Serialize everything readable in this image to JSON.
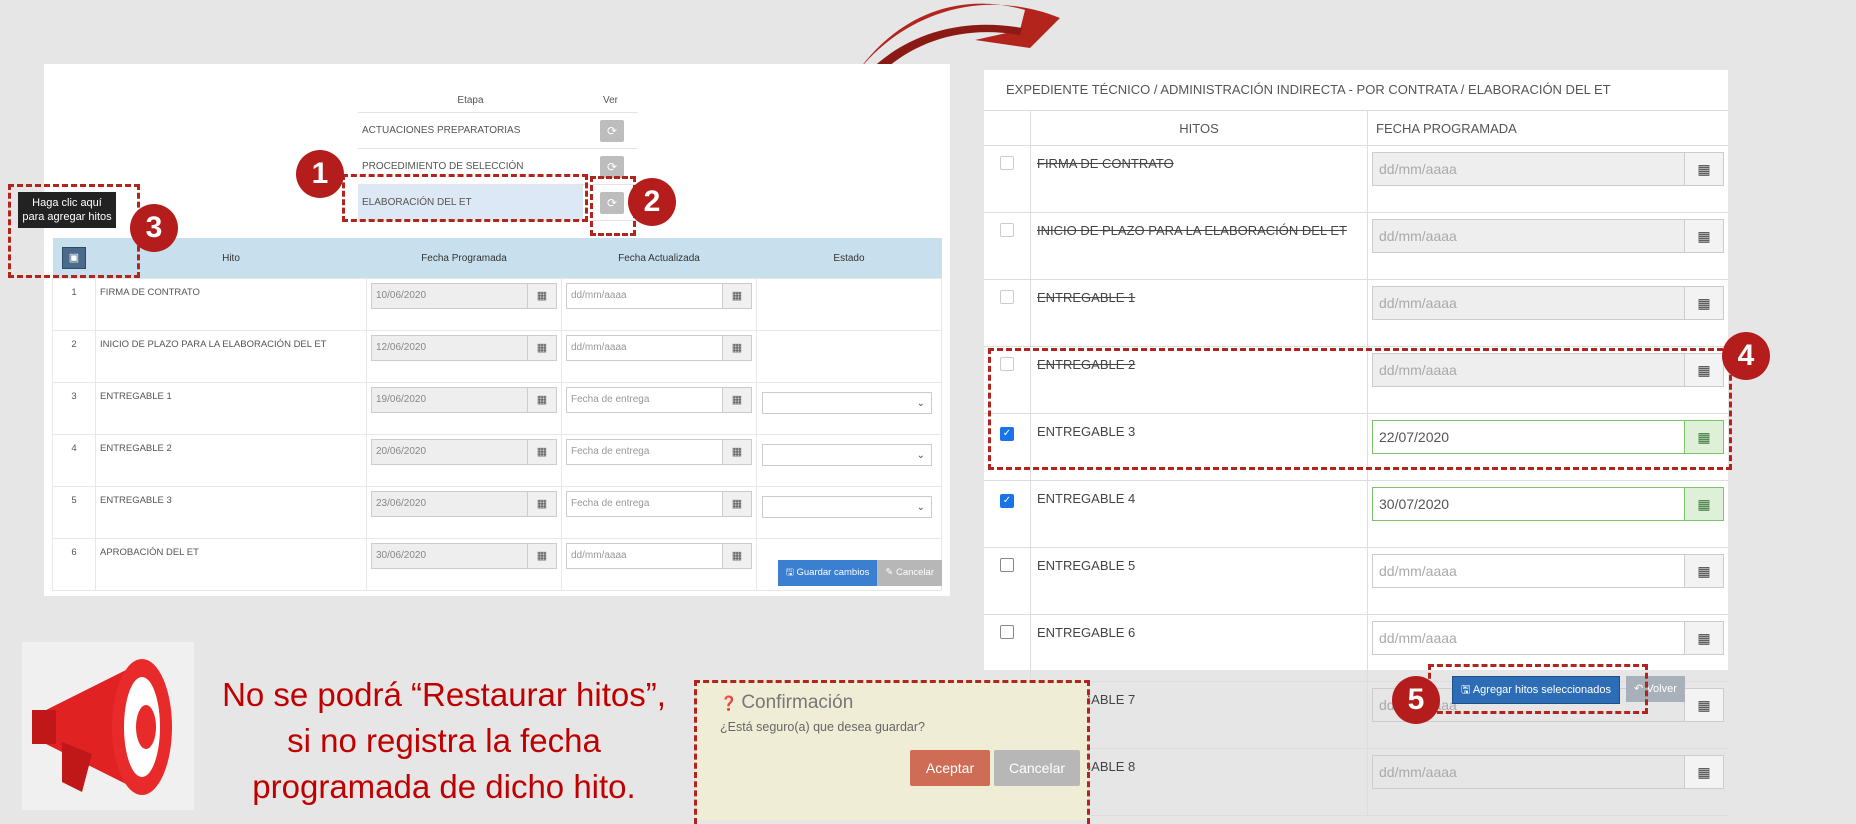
{
  "left": {
    "etapa_header": "Etapa",
    "ver_header": "Ver",
    "etapas": [
      {
        "name": "ACTUACIONES PREPARATORIAS"
      },
      {
        "name": "PROCEDIMIENTO DE SELECCIÓN"
      },
      {
        "name": "ELABORACIÓN DEL ET"
      }
    ],
    "tooltip": "Haga clic aquí para agregar hitos",
    "columns": {
      "hito": "Hito",
      "fecha_prog": "Fecha Programada",
      "fecha_act": "Fecha Actualizada",
      "estado": "Estado"
    },
    "rows": [
      {
        "num": "1",
        "name": "FIRMA DE CONTRATO",
        "prog": "10/06/2020",
        "act": "dd/mm/aaaa"
      },
      {
        "num": "2",
        "name": "INICIO DE PLAZO PARA LA ELABORACIÓN DEL ET",
        "prog": "12/06/2020",
        "act": "dd/mm/aaaa"
      },
      {
        "num": "3",
        "name": "ENTREGABLE 1",
        "prog": "19/06/2020",
        "act": "Fecha de entrega"
      },
      {
        "num": "4",
        "name": "ENTREGABLE 2",
        "prog": "20/06/2020",
        "act": "Fecha de entrega"
      },
      {
        "num": "5",
        "name": "ENTREGABLE 3",
        "prog": "23/06/2020",
        "act": "Fecha de entrega"
      },
      {
        "num": "6",
        "name": "APROBACIÓN DEL ET",
        "prog": "30/06/2020",
        "act": "dd/mm/aaaa"
      }
    ],
    "save_btn": "Guardar cambios",
    "cancel_btn": "Cancelar"
  },
  "badges": {
    "b1": "1",
    "b2": "2",
    "b3": "3",
    "b4": "4",
    "b5": "5"
  },
  "right": {
    "title": "EXPEDIENTE TÉCNICO / ADMINISTRACIÓN INDIRECTA - POR CONTRATA / ELABORACIÓN DEL ET",
    "col_hitos": "HITOS",
    "col_fecha": "FECHA PROGRAMADA",
    "rows": [
      {
        "name": "FIRMA DE CONTRATO",
        "date": "dd/mm/aaaa"
      },
      {
        "name": "INICIO DE PLAZO PARA LA ELABORACIÓN DEL ET",
        "date": "dd/mm/aaaa"
      },
      {
        "name": "ENTREGABLE 1",
        "date": "dd/mm/aaaa"
      },
      {
        "name": "ENTREGABLE 2",
        "date": "dd/mm/aaaa"
      },
      {
        "name": "ENTREGABLE 3",
        "date": "22/07/2020"
      },
      {
        "name": "ENTREGABLE 4",
        "date": "30/07/2020"
      },
      {
        "name": "ENTREGABLE 5",
        "date": "dd/mm/aaaa"
      },
      {
        "name": "ENTREGABLE 6",
        "date": "dd/mm/aaaa"
      },
      {
        "name": "ENTREGABLE 7",
        "date": "dd/mm/aaaa"
      },
      {
        "name": "ENTREGABLE 8",
        "date": "dd/mm/aaaa"
      }
    ],
    "add_btn": "Agregar hitos seleccionados",
    "back_btn": "Volver"
  },
  "warning": {
    "line1": "No se podrá “Restaurar hitos”,",
    "line2": "si no registra la fecha",
    "line3": "programada de dicho hito."
  },
  "confirm": {
    "title": "Confirmación",
    "question": "¿Está seguro(a) que desea guardar?",
    "ok": "Aceptar",
    "cancel": "Cancelar"
  },
  "colors": {
    "accent_red": "#b51c1c",
    "table_header": "#c8e0ee",
    "primary_blue": "#3b7fd1"
  }
}
